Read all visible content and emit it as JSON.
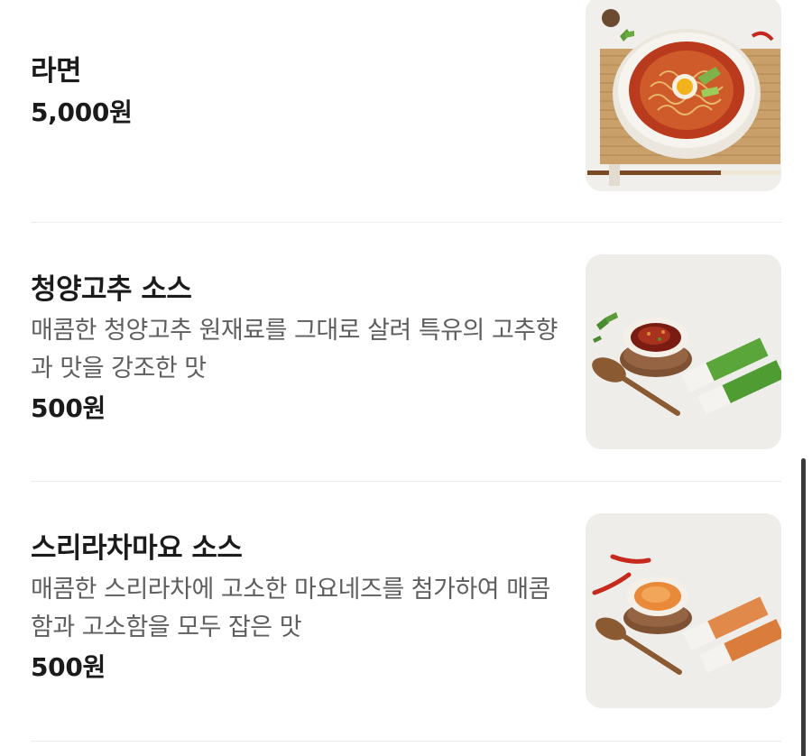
{
  "menu": {
    "items": [
      {
        "name": "라면",
        "description": "",
        "price": "5,000원",
        "image": "ramen-photo"
      },
      {
        "name": "청양고추 소스",
        "description": "매콤한 청양고추 원재료를 그대로 살려 특유의 고추향과 맛을 강조한 맛",
        "price": "500원",
        "image": "cheongyang-pepper-sauce-photo"
      },
      {
        "name": "스리라차마요 소스",
        "description": "매콤한 스리라차에 고소한 마요네즈를 첨가하여 매콤함과 고소함을 모두 잡은 맛",
        "price": "500원",
        "image": "sriracha-mayo-sauce-photo"
      }
    ]
  }
}
